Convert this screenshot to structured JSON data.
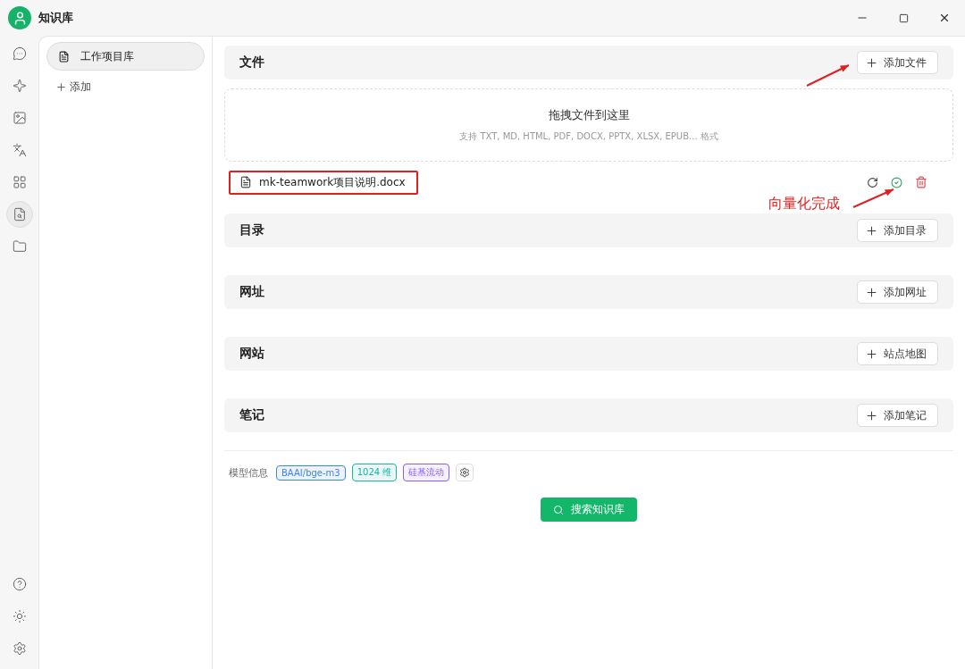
{
  "window": {
    "title": "知识库"
  },
  "rail": [
    {
      "selected": false
    },
    {
      "selected": false
    },
    {
      "selected": false
    },
    {
      "selected": false
    },
    {
      "selected": false
    },
    {
      "selected": true
    },
    {
      "selected": false
    }
  ],
  "sidebar": {
    "items": [
      {
        "label": "工作项目库",
        "selected": true
      }
    ],
    "add": "添加"
  },
  "sections": [
    {
      "title": "文件",
      "button": "添加文件",
      "dropzone": {
        "title": "拖拽文件到这里",
        "hint": "支持 TXT, MD, HTML, PDF, DOCX, PPTX, XLSX, EPUB... 格式"
      },
      "files": [
        {
          "name": "mk-teamwork项目说明.docx",
          "vectorized": true,
          "highlighted": true,
          "note": "向量化完成"
        }
      ]
    },
    {
      "title": "目录",
      "button": "添加目录"
    },
    {
      "title": "网址",
      "button": "添加网址"
    },
    {
      "title": "网站",
      "button": "站点地图"
    },
    {
      "title": "笔记",
      "button": "添加笔记"
    }
  ],
  "model_info": {
    "label": "模型信息",
    "tags": [
      {
        "text": "BAAI/bge-m3",
        "color": "#3b82f6"
      },
      {
        "text": "1024 维",
        "color": "#14b8a6"
      },
      {
        "text": "硅基流动",
        "color": "#8b5cf6"
      }
    ]
  },
  "search_button": "搜索知识库"
}
